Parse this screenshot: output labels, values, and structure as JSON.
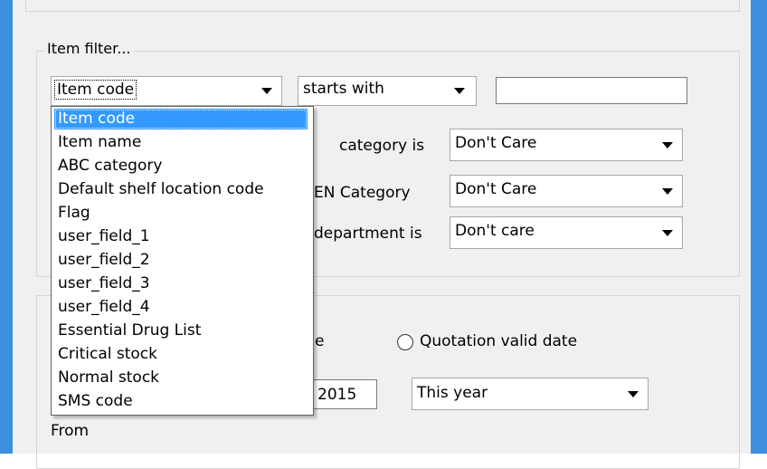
{
  "item_filter": {
    "legend": "Item filter...",
    "field_combo": {
      "selected": "Item code"
    },
    "operator_combo": {
      "selected": "starts with"
    },
    "value_input": {
      "value": ""
    },
    "dropdown_options": [
      "Item code",
      "Item name",
      "ABC category",
      "Default shelf location code",
      "Flag",
      "user_field_1",
      "user_field_2",
      "user_field_3",
      "user_field_4",
      "Essential Drug List",
      "Critical stock",
      "Normal stock",
      "SMS code"
    ],
    "category_row": {
      "label": "category is",
      "value": "Don't Care"
    },
    "ven_row": {
      "label": "EN Category",
      "value": "Don't Care"
    },
    "department_row": {
      "label": "department is",
      "value": "Don't care"
    }
  },
  "date_section": {
    "partial_label": "e",
    "quotation_radio_label": "Quotation valid date",
    "year_input_value": "2015",
    "period_combo": {
      "selected": "This year"
    },
    "from_label": "From"
  },
  "colors": {
    "window_frame": "#3b8fde",
    "selection": "#3399ff",
    "background": "#f0f0f0"
  }
}
